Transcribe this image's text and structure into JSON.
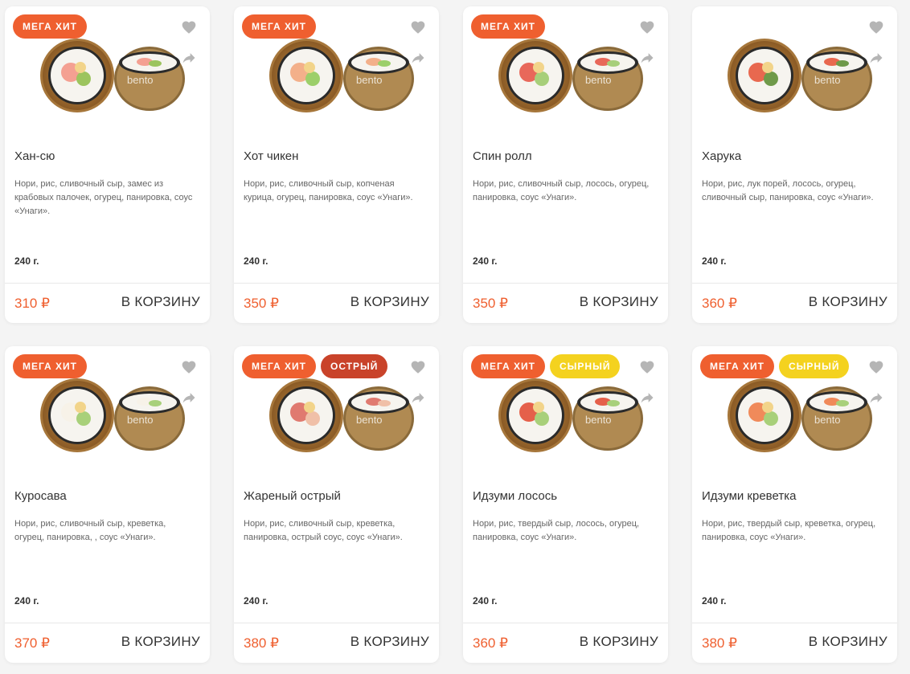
{
  "colors": {
    "accent": "#ef5f2f",
    "spicy": "#c9432a",
    "cheese": "#f4d21f",
    "icon": "#b5b5b5"
  },
  "icons": {
    "favorite": "heart-icon",
    "share": "share-icon"
  },
  "products": [
    {
      "badges": [
        {
          "label": "МЕГА ХИТ",
          "kind": "hit"
        }
      ],
      "image_caption": "bento",
      "name": "Хан-сю",
      "description": "Нори, рис, сливочный сыр, замес из крабовых палочек, огурец, панировка, соус «Унаги».",
      "weight": "240 г.",
      "price": "310 ₽",
      "cart_label": "В КОРЗИНУ"
    },
    {
      "badges": [
        {
          "label": "МЕГА ХИТ",
          "kind": "hit"
        }
      ],
      "image_caption": "bento",
      "name": "Хот чикен",
      "description": "Нори, рис, сливочный сыр, копченая курица, огурец, панировка, соус «Унаги».",
      "weight": "240 г.",
      "price": "350 ₽",
      "cart_label": "В КОРЗИНУ"
    },
    {
      "badges": [
        {
          "label": "МЕГА ХИТ",
          "kind": "hit"
        }
      ],
      "image_caption": "bento",
      "name": "Спин ролл",
      "description": "Нори, рис, сливочный сыр, лосось, огурец, панировка, соус «Унаги».",
      "weight": "240 г.",
      "price": "350 ₽",
      "cart_label": "В КОРЗИНУ"
    },
    {
      "badges": [],
      "image_caption": "bento",
      "name": "Харука",
      "description": "Нори, рис, лук порей, лосось, огурец, сливочный сыр, панировка, соус «Унаги».",
      "weight": "240 г.",
      "price": "360 ₽",
      "cart_label": "В КОРЗИНУ"
    },
    {
      "badges": [
        {
          "label": "МЕГА ХИТ",
          "kind": "hit"
        }
      ],
      "image_caption": "bento",
      "name": "Куросава",
      "description": "Нори, рис, сливочный сыр, креветка, огурец, панировка, , соус «Унаги».",
      "weight": "240 г.",
      "price": "370 ₽",
      "cart_label": "В КОРЗИНУ"
    },
    {
      "badges": [
        {
          "label": "МЕГА ХИТ",
          "kind": "hit"
        },
        {
          "label": "ОСТРЫЙ",
          "kind": "spicy"
        }
      ],
      "image_caption": "bento",
      "name": "Жареный острый",
      "description": "Нори, рис, сливочный сыр, креветка, панировка, острый соус, соус «Унаги».",
      "weight": "240 г.",
      "price": "380 ₽",
      "cart_label": "В КОРЗИНУ"
    },
    {
      "badges": [
        {
          "label": "МЕГА ХИТ",
          "kind": "hit"
        },
        {
          "label": "СЫРНЫЙ",
          "kind": "cheese"
        }
      ],
      "image_caption": "bento",
      "name": "Идзуми лосось",
      "description": "Нори, рис, твердый сыр, лосось, огурец, панировка, соус «Унаги».",
      "weight": "240 г.",
      "price": "360 ₽",
      "cart_label": "В КОРЗИНУ"
    },
    {
      "badges": [
        {
          "label": "МЕГА ХИТ",
          "kind": "hit"
        },
        {
          "label": "СЫРНЫЙ",
          "kind": "cheese"
        }
      ],
      "image_caption": "bento",
      "name": "Идзуми креветка",
      "description": "Нори, рис, твердый сыр, креветка, огурец, панировка, соус «Унаги».",
      "weight": "240 г.",
      "price": "380 ₽",
      "cart_label": "В КОРЗИНУ"
    }
  ]
}
